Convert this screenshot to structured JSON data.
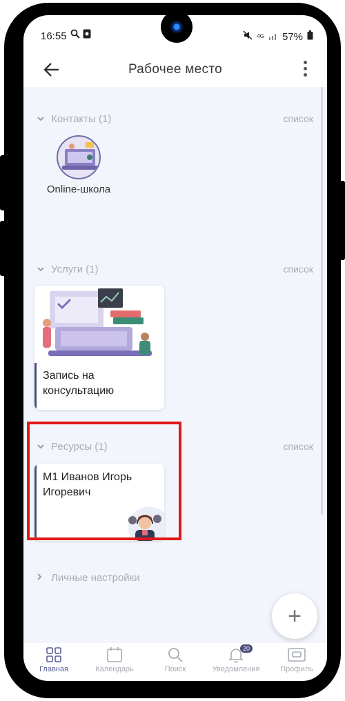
{
  "status": {
    "time": "16:55",
    "network": "4G",
    "battery": "57%"
  },
  "appbar": {
    "title": "Рабочее место"
  },
  "sections": {
    "contacts": {
      "title": "Контакты (1)",
      "action": "список",
      "items": [
        {
          "name": "Online-школа"
        }
      ]
    },
    "services": {
      "title": "Услуги (1)",
      "action": "список",
      "items": [
        {
          "title": "Запись на консультацию"
        }
      ]
    },
    "resources": {
      "title": "Ресурсы (1)",
      "action": "список",
      "items": [
        {
          "title": "М1 Иванов Игорь Игоревич"
        }
      ]
    },
    "personal": {
      "title": "Личные настройки"
    }
  },
  "fab": {
    "label": "+"
  },
  "bottom_nav": {
    "items": [
      {
        "label": "Главная",
        "icon": "grid-icon",
        "active": true
      },
      {
        "label": "Календарь",
        "icon": "calendar-icon"
      },
      {
        "label": "Поиск",
        "icon": "search-icon"
      },
      {
        "label": "Уведомления",
        "icon": "bell-icon",
        "badge": "20"
      },
      {
        "label": "Профиль",
        "icon": "profile-card-icon"
      }
    ]
  },
  "colors": {
    "accent": "#4a4c7a",
    "highlight": "#e01818",
    "background": "#f2f5fc"
  }
}
